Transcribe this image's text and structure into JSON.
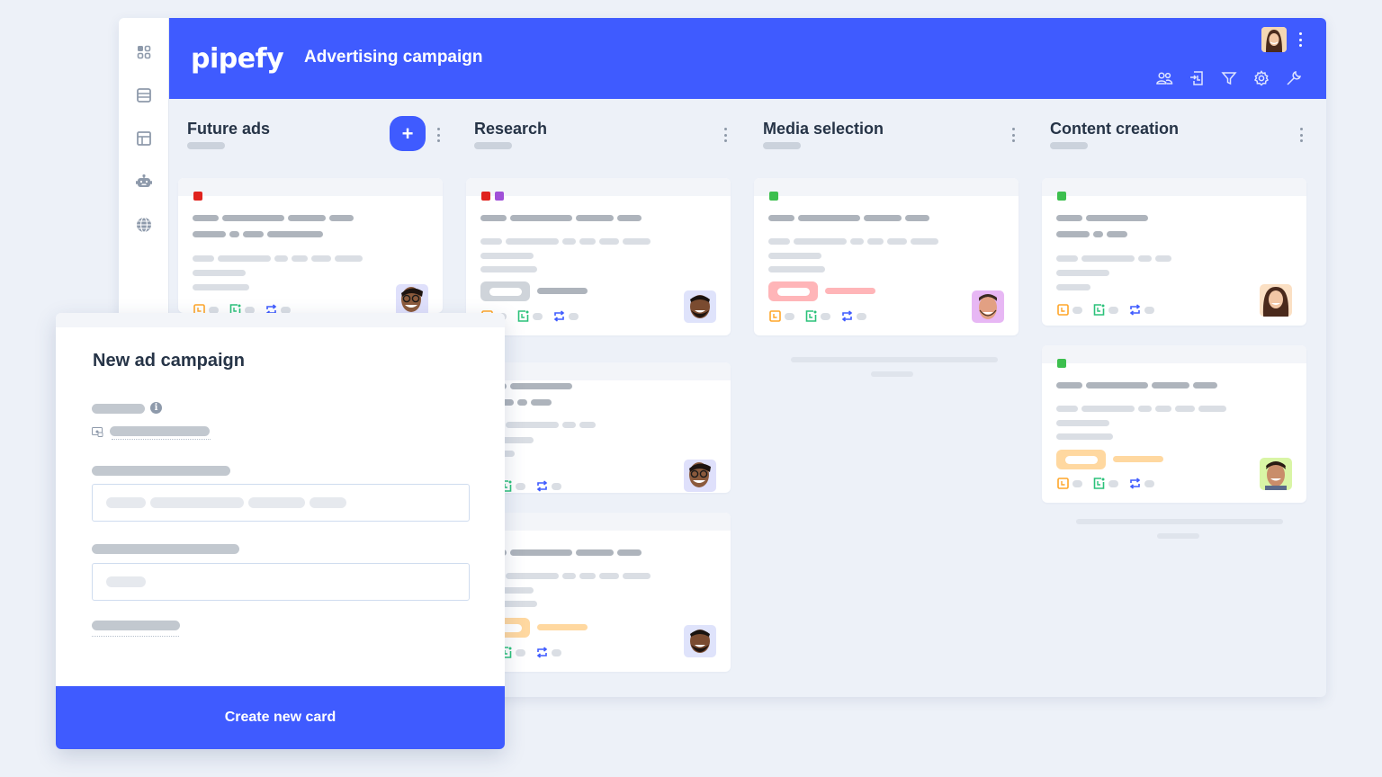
{
  "header": {
    "logo": "pipefy",
    "pipe_title": "Advertising campaign",
    "brand_color": "#3f5bff",
    "tools": [
      "members-icon",
      "import-icon",
      "filter-icon",
      "settings-icon",
      "wrench-icon"
    ]
  },
  "sidebar": {
    "items": [
      "apps-grid-icon",
      "database-icon",
      "layout-icon",
      "automation-robot-icon",
      "globe-icon"
    ]
  },
  "columns": [
    {
      "title": "Future ads",
      "has_add_button": true,
      "add_label": "+"
    },
    {
      "title": "Research"
    },
    {
      "title": "Media selection"
    },
    {
      "title": "Content creation"
    }
  ],
  "cards": {
    "label_colors": {
      "red": "#e0231e",
      "purple": "#a050d8",
      "green": "#3cbf4e"
    },
    "pill_colors": {
      "gray": "#cfd4da",
      "pink": "#ffb5b8",
      "orange": "#ffd8a0"
    }
  },
  "modal": {
    "title": "New ad campaign",
    "info_glyph": "i",
    "create_button": "Create new card"
  }
}
